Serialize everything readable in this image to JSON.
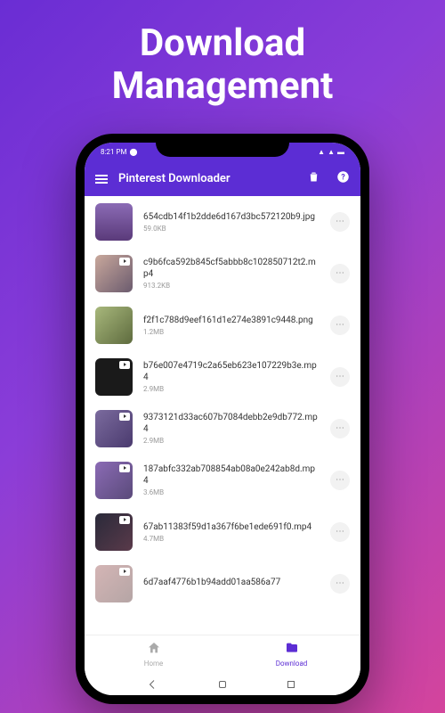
{
  "promo": {
    "line1": "Download",
    "line2": "Management"
  },
  "status_bar": {
    "time": "8:21 PM"
  },
  "header": {
    "title": "Pinterest Downloader"
  },
  "files": [
    {
      "name": "654cdb14f1b2dde6d167d3bc572120b9.jpg",
      "size": "59.0KB",
      "is_video": false
    },
    {
      "name": "c9b6fca592b845cf5abbb8c102850712t2.mp4",
      "size": "913.2KB",
      "is_video": true
    },
    {
      "name": "f2f1c788d9eef161d1e274e3891c9448.png",
      "size": "1.2MB",
      "is_video": false
    },
    {
      "name": "b76e007e4719c2a65eb623e107229b3e.mp4",
      "size": "2.9MB",
      "is_video": true
    },
    {
      "name": "9373121d33ac607b7084debb2e9db772.mp4",
      "size": "2.9MB",
      "is_video": true
    },
    {
      "name": "187abfc332ab708854ab08a0e242ab8d.mp4",
      "size": "3.6MB",
      "is_video": true
    },
    {
      "name": "67ab11383f59d1a367f6be1ede691f0.mp4",
      "size": "4.7MB",
      "is_video": true
    },
    {
      "name": "6d7aaf4776b1b94add01aa586a77",
      "size": "",
      "is_video": true
    }
  ],
  "nav": {
    "home": "Home",
    "download": "Download"
  }
}
